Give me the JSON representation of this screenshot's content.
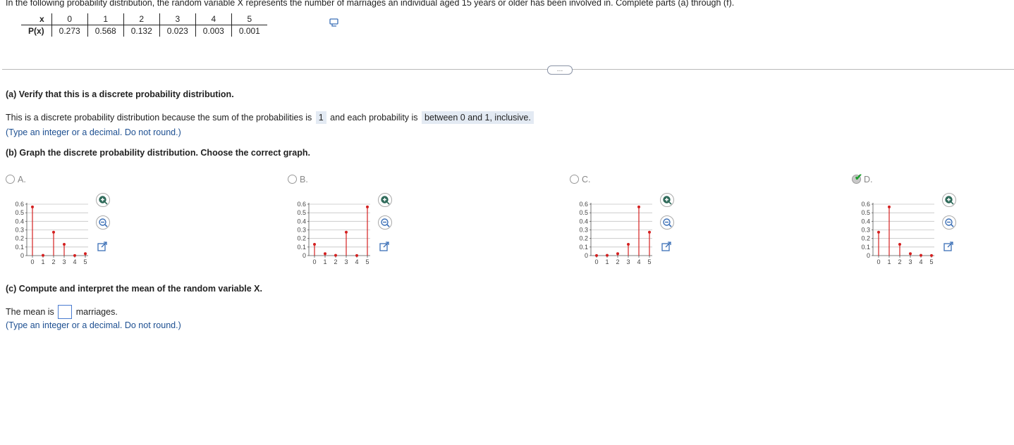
{
  "intro": "In the following probability distribution, the random variable X represents the number of marriages an individual aged 15 years or older has been involved in. Complete parts (a) through (f).",
  "table": {
    "x_label": "x",
    "p_label": "P(x)",
    "x_values": [
      "0",
      "1",
      "2",
      "3",
      "4",
      "5"
    ],
    "p_values": [
      "0.273",
      "0.568",
      "0.132",
      "0.023",
      "0.003",
      "0.001"
    ]
  },
  "more_button": "…",
  "part_a": {
    "heading": "(a) Verify that this is a discrete probability distribution.",
    "sentence_start": "This is a discrete probability distribution because the sum of the probabilities is",
    "sum_answer": "1",
    "sentence_mid": "and each probability is",
    "range_answer": "between 0 and 1, inclusive.",
    "hint": "(Type an integer or a decimal. Do not round.)"
  },
  "part_b": {
    "heading": "(b) Graph the discrete probability distribution. Choose the correct graph."
  },
  "options": [
    {
      "label": "A.",
      "selected": false,
      "values": [
        0.568,
        0.003,
        0.273,
        0.132,
        0.001,
        0.023
      ]
    },
    {
      "label": "B.",
      "selected": false,
      "values": [
        0.132,
        0.023,
        0.003,
        0.273,
        0.001,
        0.568
      ]
    },
    {
      "label": "C.",
      "selected": false,
      "values": [
        0.001,
        0.003,
        0.023,
        0.132,
        0.568,
        0.273
      ]
    },
    {
      "label": "D.",
      "selected": true,
      "values": [
        0.273,
        0.568,
        0.132,
        0.023,
        0.003,
        0.001
      ]
    }
  ],
  "chart_data": {
    "type": "scatter",
    "y_ticks": [
      "0.6",
      "0.5",
      "0.4",
      "0.3",
      "0.2",
      "0.1",
      "0"
    ],
    "x_ticks": [
      "0",
      "1",
      "2",
      "3",
      "4",
      "5"
    ],
    "ylim": [
      0,
      0.6
    ],
    "point_color": "#d42020",
    "bar_color": "#d42020"
  },
  "part_c": {
    "heading": "(c) Compute and interpret the mean of the random variable X.",
    "mean_prefix": "The mean is",
    "mean_value": "",
    "mean_suffix": "marriages.",
    "hint": "(Type an integer or a decimal. Do not round.)"
  },
  "icons": [
    "zoom-in-icon",
    "zoom-out-icon",
    "popout-icon",
    "copy-icon",
    "check-icon"
  ]
}
